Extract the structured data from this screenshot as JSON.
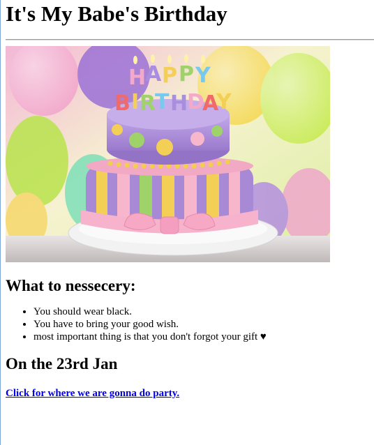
{
  "page": {
    "title": "It's My Babe's Birthday",
    "hero_image_text": "HAPPY BIRTHDAY",
    "section_heading": "What to nessecery:",
    "items": [
      "You should wear black.",
      "You have to bring your good wish.",
      "most important thing is that you don't forgot your gift ♥"
    ],
    "date_heading": "On the 23rd Jan",
    "party_link": "Click for where we are gonna do party."
  },
  "colors": {
    "link": "#0000ee",
    "divider": "#9a9a9a",
    "cake_purple": "#a889d6",
    "cake_yellow": "#f3cf55",
    "cake_pink": "#f7b6cb",
    "cake_green": "#9fd36a"
  }
}
